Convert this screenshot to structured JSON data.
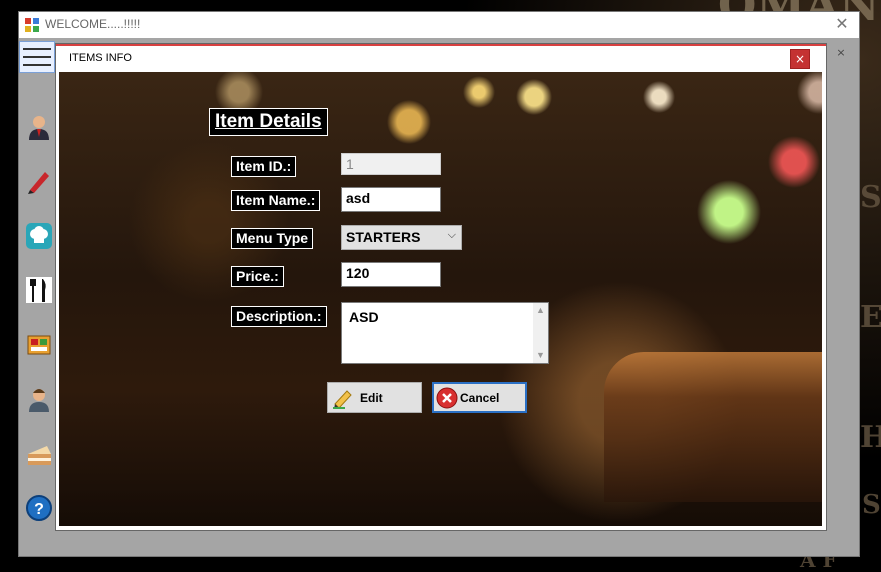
{
  "main_window": {
    "title": "WELCOME.....!!!!!",
    "close_glyph": "✕"
  },
  "sidebar": {
    "items": [
      {
        "icon": "user-manager-icon"
      },
      {
        "icon": "pen-icon"
      },
      {
        "icon": "chef-hat-icon"
      },
      {
        "icon": "fork-knife-icon"
      },
      {
        "icon": "menu-card-icon"
      },
      {
        "icon": "customer-icon"
      },
      {
        "icon": "cake-icon"
      },
      {
        "icon": "help-icon"
      }
    ]
  },
  "child_window": {
    "title": "ITEMS INFO",
    "close_glyph": "×",
    "ghost_close_glyph": "×"
  },
  "form": {
    "heading": "Item Details",
    "item_id": {
      "label": "Item ID.:",
      "value": "1"
    },
    "item_name": {
      "label": "Item Name.:",
      "value": "asd"
    },
    "menu_type": {
      "label": "Menu Type",
      "value": "STARTERS"
    },
    "price": {
      "label": "Price.:",
      "value": "120"
    },
    "description": {
      "label": "Description.:",
      "value": "ASD"
    },
    "edit_button": "Edit",
    "cancel_button": "Cancel"
  },
  "colors": {
    "accent_focus": "#2a6fc4",
    "close_red": "#c43232",
    "label_bg": "#000000"
  }
}
